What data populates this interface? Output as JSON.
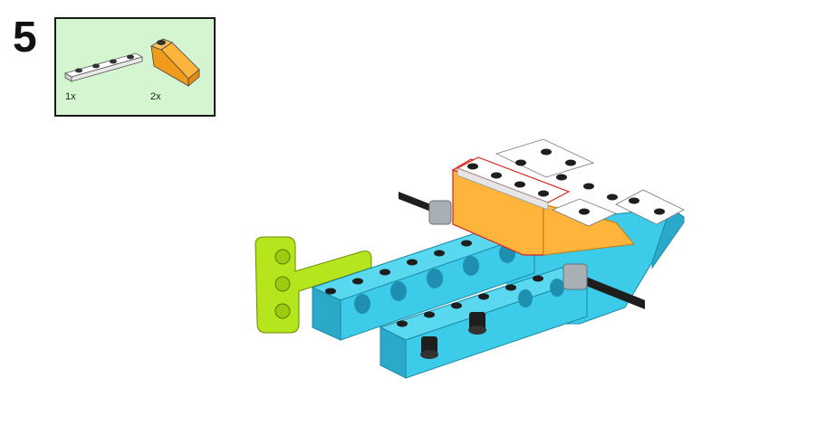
{
  "step": {
    "number": "5"
  },
  "parts": [
    {
      "name": "white-plate-1x4",
      "quantity": "1x"
    },
    {
      "name": "orange-slope-brick",
      "quantity": "2x"
    }
  ],
  "colors": {
    "parts_background": "#d4f5d0",
    "white_part": "#ffffff",
    "orange_part": "#ffb43c",
    "azure_beam": "#3ccbe8",
    "lime_beam": "#b5e61d",
    "pin_black": "#1e1e1e",
    "axle_gray": "#a9b0b5"
  }
}
